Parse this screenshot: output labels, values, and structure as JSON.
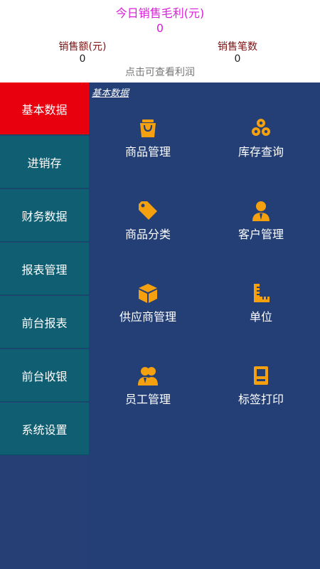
{
  "header": {
    "profit_title": "今日销售毛利(元)",
    "profit_value": "0",
    "sales_amount_label": "销售额(元)",
    "sales_amount_value": "0",
    "sales_count_label": "销售笔数",
    "sales_count_value": "0",
    "check_profit_link": "点击可查看利润"
  },
  "sidebar": {
    "items": [
      {
        "label": "基本数据",
        "active": true
      },
      {
        "label": "进销存"
      },
      {
        "label": "财务数据"
      },
      {
        "label": "报表管理"
      },
      {
        "label": "前台报表"
      },
      {
        "label": "前台收银"
      },
      {
        "label": "系统设置"
      }
    ]
  },
  "main": {
    "section_label": "基本数据",
    "items": [
      {
        "label": "商品管理",
        "icon": "shopping-bag-icon"
      },
      {
        "label": "库存查询",
        "icon": "stock-circles-icon"
      },
      {
        "label": "商品分类",
        "icon": "tag-icon"
      },
      {
        "label": "客户管理",
        "icon": "customer-person-icon"
      },
      {
        "label": "供应商管理",
        "icon": "box-icon"
      },
      {
        "label": "单位",
        "icon": "ruler-icon"
      },
      {
        "label": "员工管理",
        "icon": "staff-group-icon"
      },
      {
        "label": "标签打印",
        "icon": "printer-icon"
      }
    ]
  },
  "colors": {
    "accent_magenta": "#d81ed8",
    "active_red": "#e8000e",
    "sidebar_teal": "#0f5e72",
    "main_navy": "#233f75",
    "icon_orange": "#f5a10f"
  }
}
